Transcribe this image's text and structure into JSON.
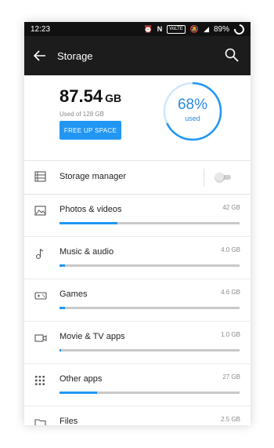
{
  "status_bar": {
    "time": "12:23",
    "battery": "89%",
    "icons": [
      "alarm-icon",
      "nfc-icon",
      "volte-icon",
      "mute-icon",
      "signal-icon",
      "battery-icon"
    ],
    "volte_label": "VoLTE"
  },
  "app_bar": {
    "title": "Storage",
    "icons": [
      "back-arrow-icon",
      "search-icon"
    ]
  },
  "summary": {
    "used_amount": "87.54",
    "used_unit": "GB",
    "used_of": "Used of 128 GB",
    "free_button": "FREE UP SPACE",
    "percent": "68%",
    "percent_label": "used",
    "percent_value": 68
  },
  "storage_manager": {
    "label": "Storage manager",
    "enabled": false
  },
  "categories": [
    {
      "label": "Photos & videos",
      "size": "42 GB",
      "fill": 0.32,
      "icon": "image-icon"
    },
    {
      "label": "Music & audio",
      "size": "4.0 GB",
      "fill": 0.03,
      "icon": "music-note-icon"
    },
    {
      "label": "Games",
      "size": "4.6 GB",
      "fill": 0.03,
      "icon": "gamepad-icon"
    },
    {
      "label": "Movie & TV apps",
      "size": "1.0 GB",
      "fill": 0.01,
      "icon": "video-camera-icon"
    },
    {
      "label": "Other apps",
      "size": "27 GB",
      "fill": 0.21,
      "icon": "apps-grid-icon"
    },
    {
      "label": "Files",
      "size": "2.5 GB",
      "fill": 0.02,
      "icon": "folder-icon"
    }
  ],
  "colors": {
    "accent": "#2196f3",
    "app_bar": "#1c1c1c",
    "track": "#c9c9c9"
  }
}
